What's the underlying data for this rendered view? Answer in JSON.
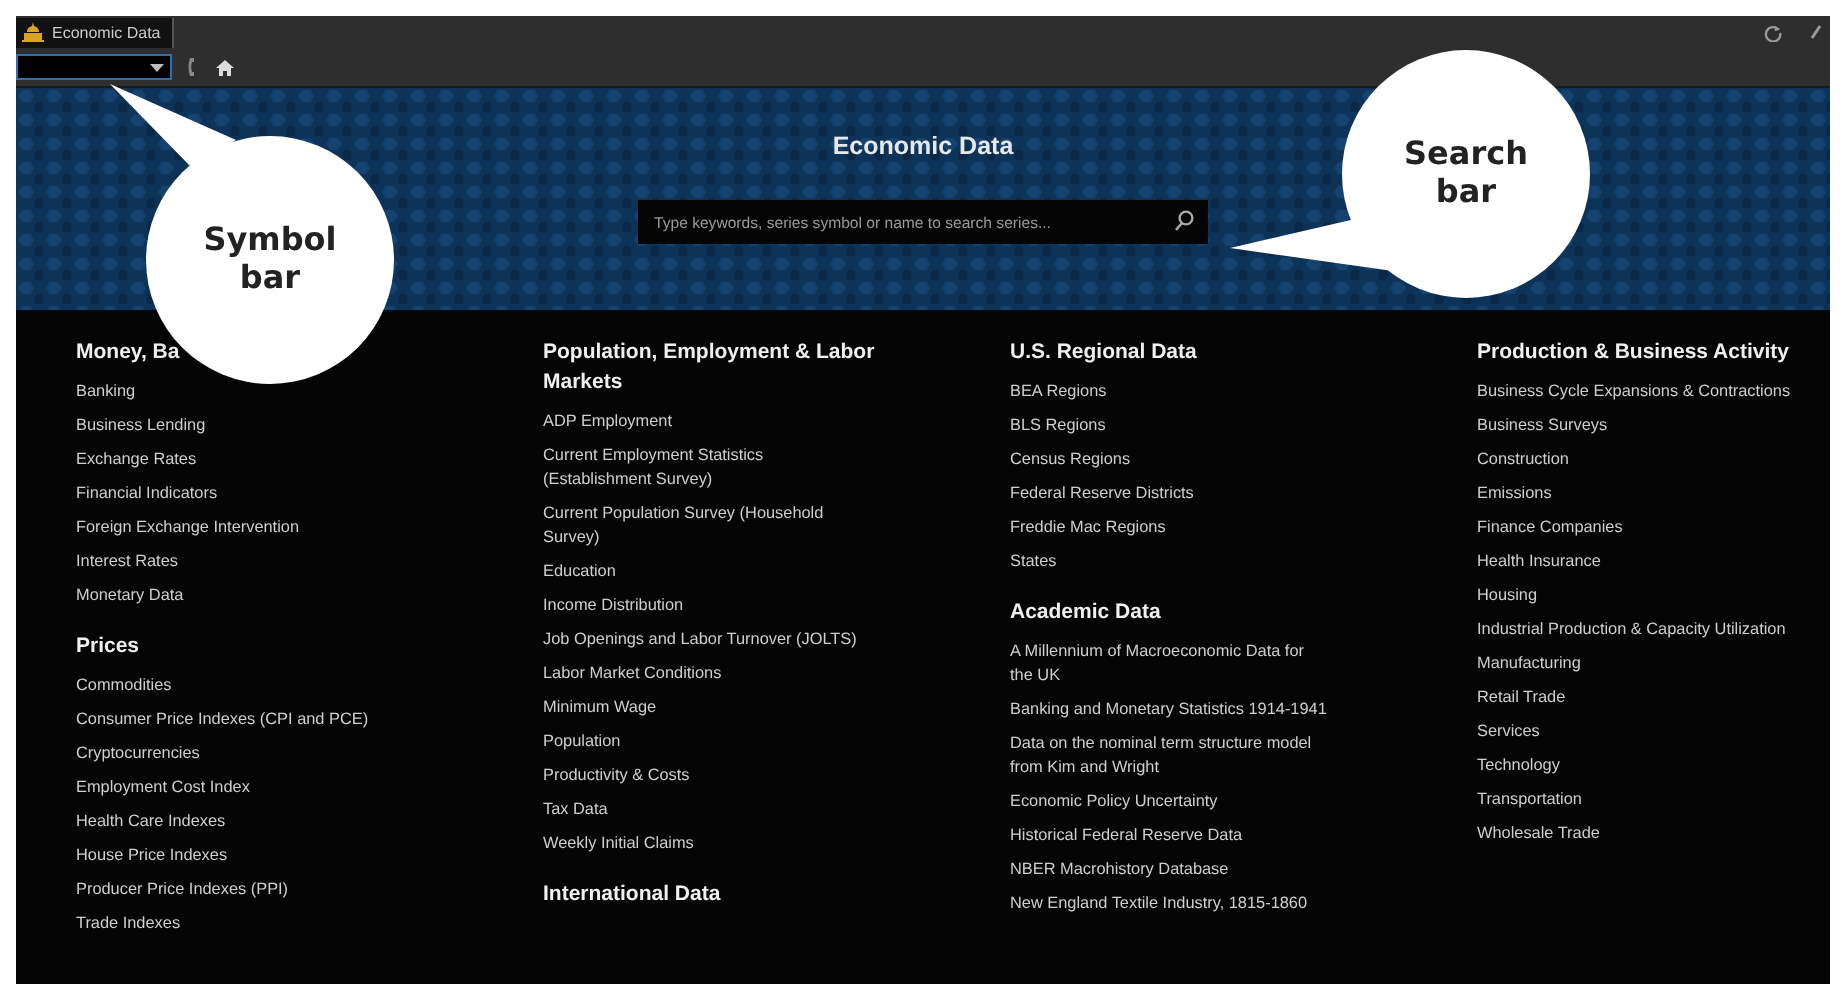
{
  "window": {
    "tab_title": "Economic Data"
  },
  "banner": {
    "title": "Economic Data",
    "search": {
      "placeholder": "Type keywords, series symbol or name to search series..."
    }
  },
  "columns": [
    [
      {
        "heading": "Money, Ba",
        "items": [
          "Banking",
          "Business Lending",
          "Exchange Rates",
          "Financial Indicators",
          "Foreign Exchange Intervention",
          "Interest Rates",
          "Monetary Data"
        ]
      },
      {
        "heading": "Prices",
        "items": [
          "Commodities",
          "Consumer Price Indexes (CPI and PCE)",
          "Cryptocurrencies",
          "Employment Cost Index",
          "Health Care Indexes",
          "House Price Indexes",
          "Producer Price Indexes (PPI)",
          "Trade Indexes"
        ]
      }
    ],
    [
      {
        "heading": "Population, Employment & Labor Markets",
        "items": [
          "ADP Employment",
          "Current Employment Statistics (Establishment Survey)",
          "Current Population Survey (Household Survey)",
          "Education",
          "Income Distribution",
          "Job Openings and Labor Turnover (JOLTS)",
          "Labor Market Conditions",
          "Minimum Wage",
          "Population",
          "Productivity & Costs",
          "Tax Data",
          "Weekly Initial Claims"
        ]
      },
      {
        "heading": "International Data"
      }
    ],
    [
      {
        "heading": "U.S. Regional Data",
        "items": [
          "BEA Regions",
          "BLS Regions",
          "Census Regions",
          "Federal Reserve Districts",
          "Freddie Mac Regions",
          "States"
        ]
      },
      {
        "heading": "Academic Data",
        "items": [
          "A Millennium of Macroeconomic Data for the UK",
          "Banking and Monetary Statistics 1914-1941",
          "Data on the nominal term structure model from Kim and Wright",
          "Economic Policy Uncertainty",
          "Historical Federal Reserve Data",
          "NBER Macrohistory Database",
          "New England Textile Industry, 1815-1860"
        ]
      }
    ],
    [
      {
        "heading": "Production & Business Activity",
        "items": [
          "Business Cycle Expansions & Contractions",
          "Business Surveys",
          "Construction",
          "Emissions",
          "Finance Companies",
          "Health Insurance",
          "Housing",
          "Industrial Production & Capacity Utilization",
          "Manufacturing",
          "Retail Trade",
          "Services",
          "Technology",
          "Transportation",
          "Wholesale Trade"
        ]
      }
    ]
  ],
  "callouts": [
    {
      "kind": "symbol",
      "label": "Symbol bar"
    },
    {
      "kind": "search",
      "label": "Search bar"
    }
  ]
}
